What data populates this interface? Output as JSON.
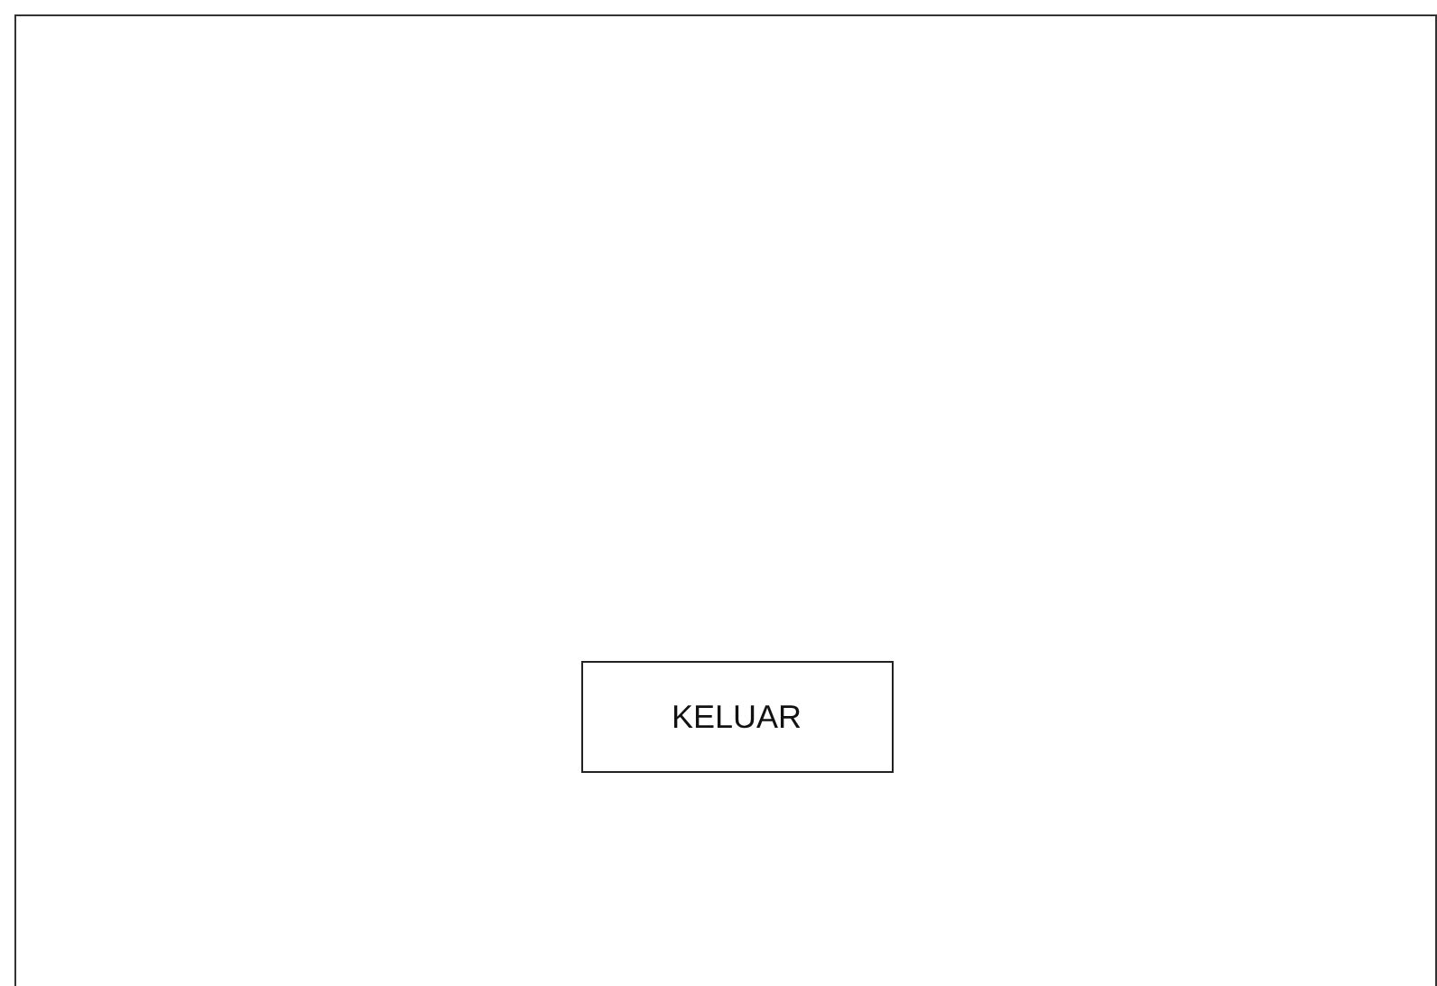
{
  "buttons": [
    {
      "label": "KELUAR"
    }
  ]
}
